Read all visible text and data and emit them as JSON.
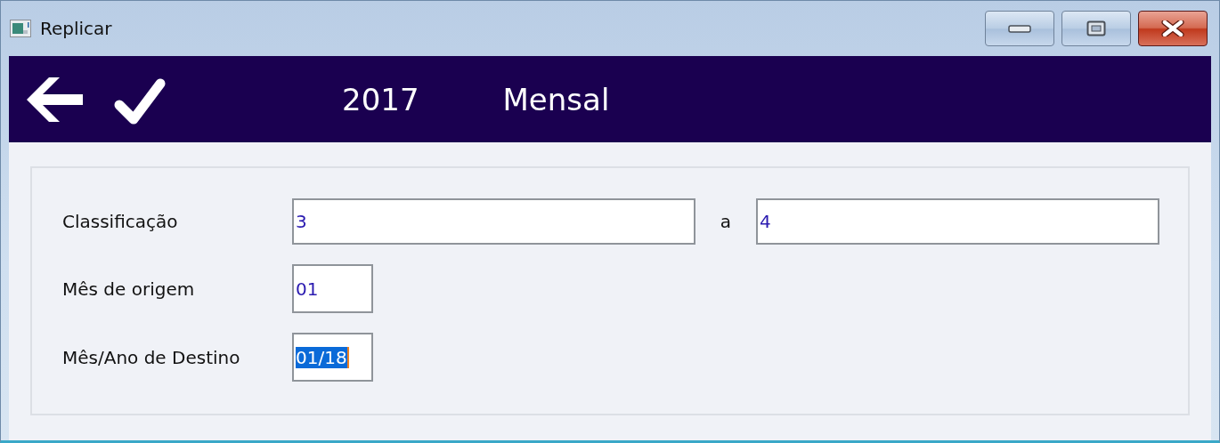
{
  "window": {
    "title": "Replicar"
  },
  "toolbar": {
    "year": "2017",
    "period": "Mensal"
  },
  "form": {
    "rows": [
      {
        "label": "Classificação",
        "fields": [
          {
            "value": "3",
            "kind": "wide",
            "selected": false
          },
          {
            "value": "4",
            "kind": "wide",
            "selected": false
          }
        ],
        "separator": "a"
      },
      {
        "label": "Mês de origem",
        "fields": [
          {
            "value": "01",
            "kind": "short",
            "selected": false
          }
        ]
      },
      {
        "label": "Mês/Ano de Destino",
        "fields": [
          {
            "value": "01/18",
            "kind": "short",
            "selected": true
          }
        ]
      }
    ]
  }
}
